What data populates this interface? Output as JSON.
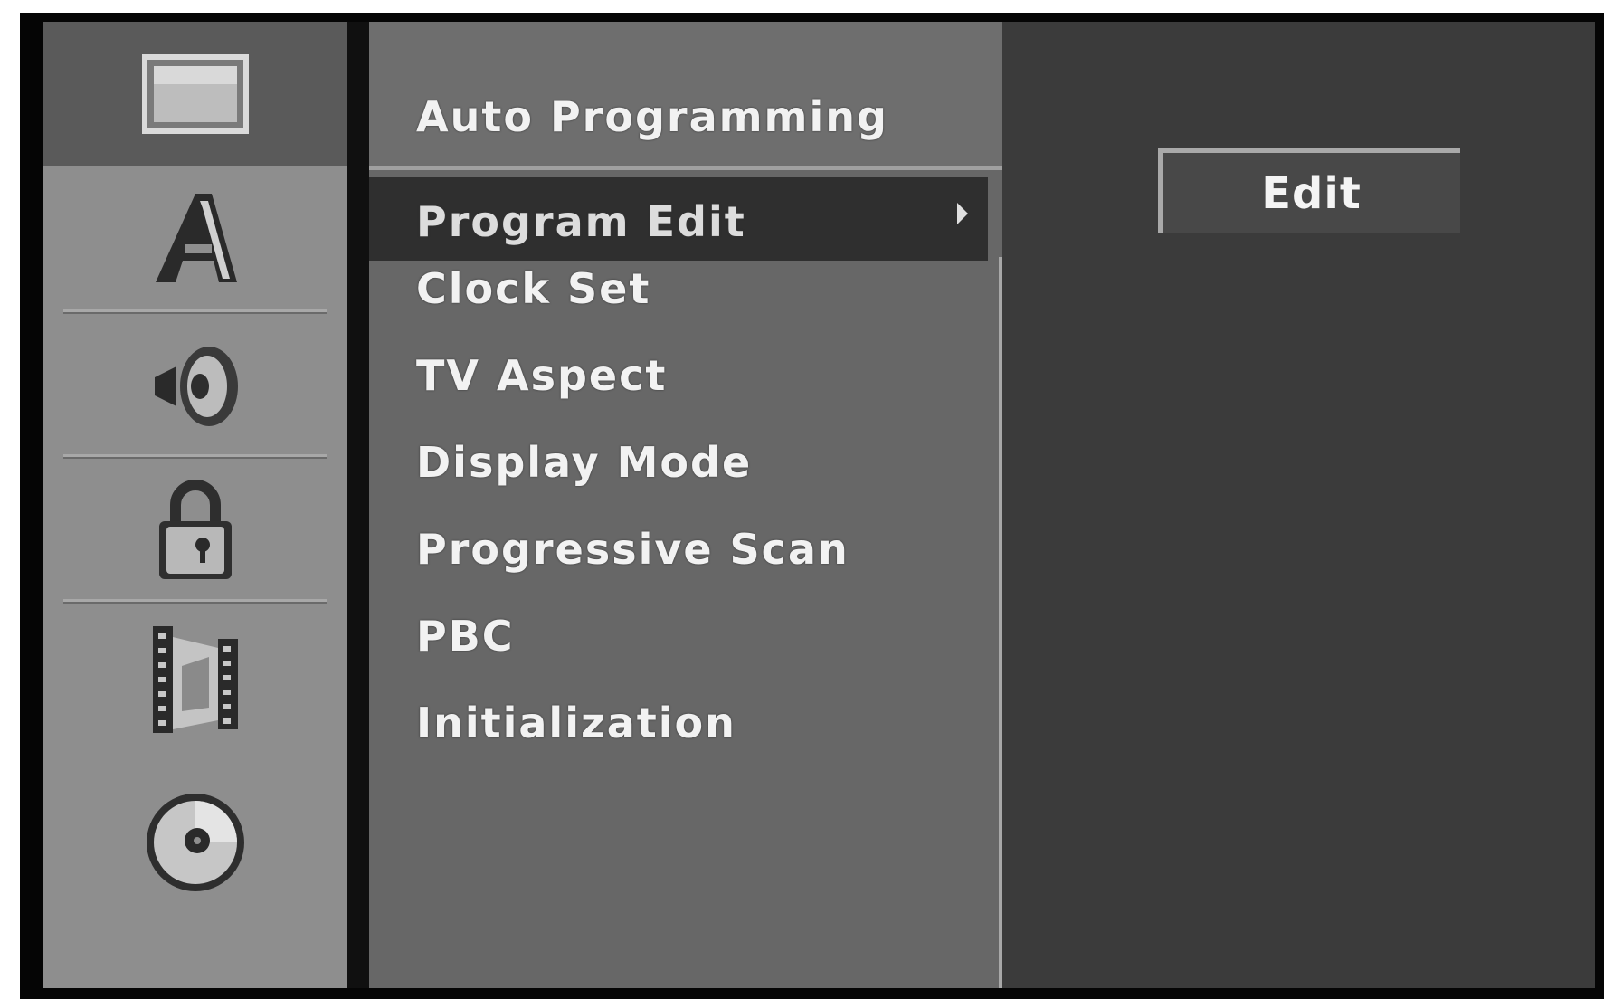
{
  "sidebar": {
    "items": [
      {
        "icon": "tv-screen-icon",
        "active": true
      },
      {
        "icon": "language-a-icon",
        "active": false
      },
      {
        "icon": "speaker-icon",
        "active": false
      },
      {
        "icon": "padlock-icon",
        "active": false
      },
      {
        "icon": "film-reel-icon",
        "active": false
      },
      {
        "icon": "disc-icon",
        "active": false
      }
    ]
  },
  "menu": {
    "items": [
      {
        "label": "Auto Programming"
      },
      {
        "label": "Program Edit",
        "selected": true,
        "has_submenu": true
      },
      {
        "label": "Clock Set"
      },
      {
        "label": "TV Aspect"
      },
      {
        "label": "Display Mode"
      },
      {
        "label": "Progressive Scan"
      },
      {
        "label": "PBC"
      },
      {
        "label": "Initialization"
      }
    ]
  },
  "submenu": {
    "edit_label": "Edit"
  },
  "colors": {
    "sidebar_bg": "#8e8e8e",
    "sidebar_active_bg": "#5a5a5a",
    "menu_bg": "#676767",
    "menu_selected_bg": "#2f2f2f",
    "panel_bg": "#3b3b3b",
    "text": "#f2f2f2"
  }
}
